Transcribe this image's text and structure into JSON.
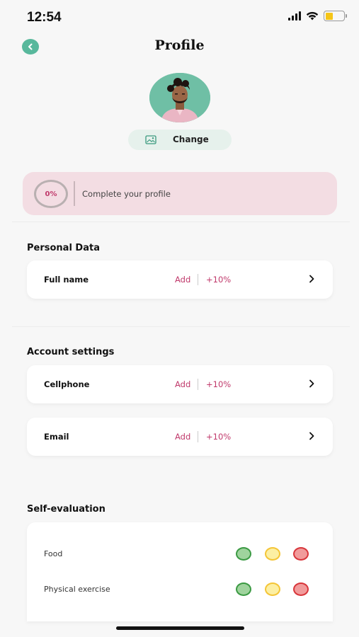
{
  "status_bar": {
    "time": "12:54"
  },
  "header": {
    "title": "Profile",
    "back_icon": "chevron-left-icon",
    "accent": "#58b89c"
  },
  "avatar": {
    "icon": "person-avatar"
  },
  "change_photo": {
    "label": "Change",
    "icon": "image-icon"
  },
  "profile_progress": {
    "percent_text": "0%",
    "percent": 0,
    "text": "Complete your profile"
  },
  "personal_data": {
    "title": "Personal Data",
    "rows": [
      {
        "label": "Full name",
        "action": "Add",
        "bonus": "+10%"
      }
    ]
  },
  "account_settings": {
    "title": "Account settings",
    "rows": [
      {
        "label": "Cellphone",
        "action": "Add",
        "bonus": "+10%"
      },
      {
        "label": "Email",
        "action": "Add",
        "bonus": "+10%"
      }
    ]
  },
  "self_evaluation": {
    "title": "Self-evaluation",
    "rows": [
      {
        "label": "Food"
      },
      {
        "label": "Physical exercise"
      }
    ],
    "rating_colors": {
      "good": "#3b9a43",
      "medium": "#f4c537",
      "bad": "#d8363b"
    }
  },
  "colors": {
    "accent_pink": "#c0396b",
    "progress_bg": "#f3dde3"
  }
}
